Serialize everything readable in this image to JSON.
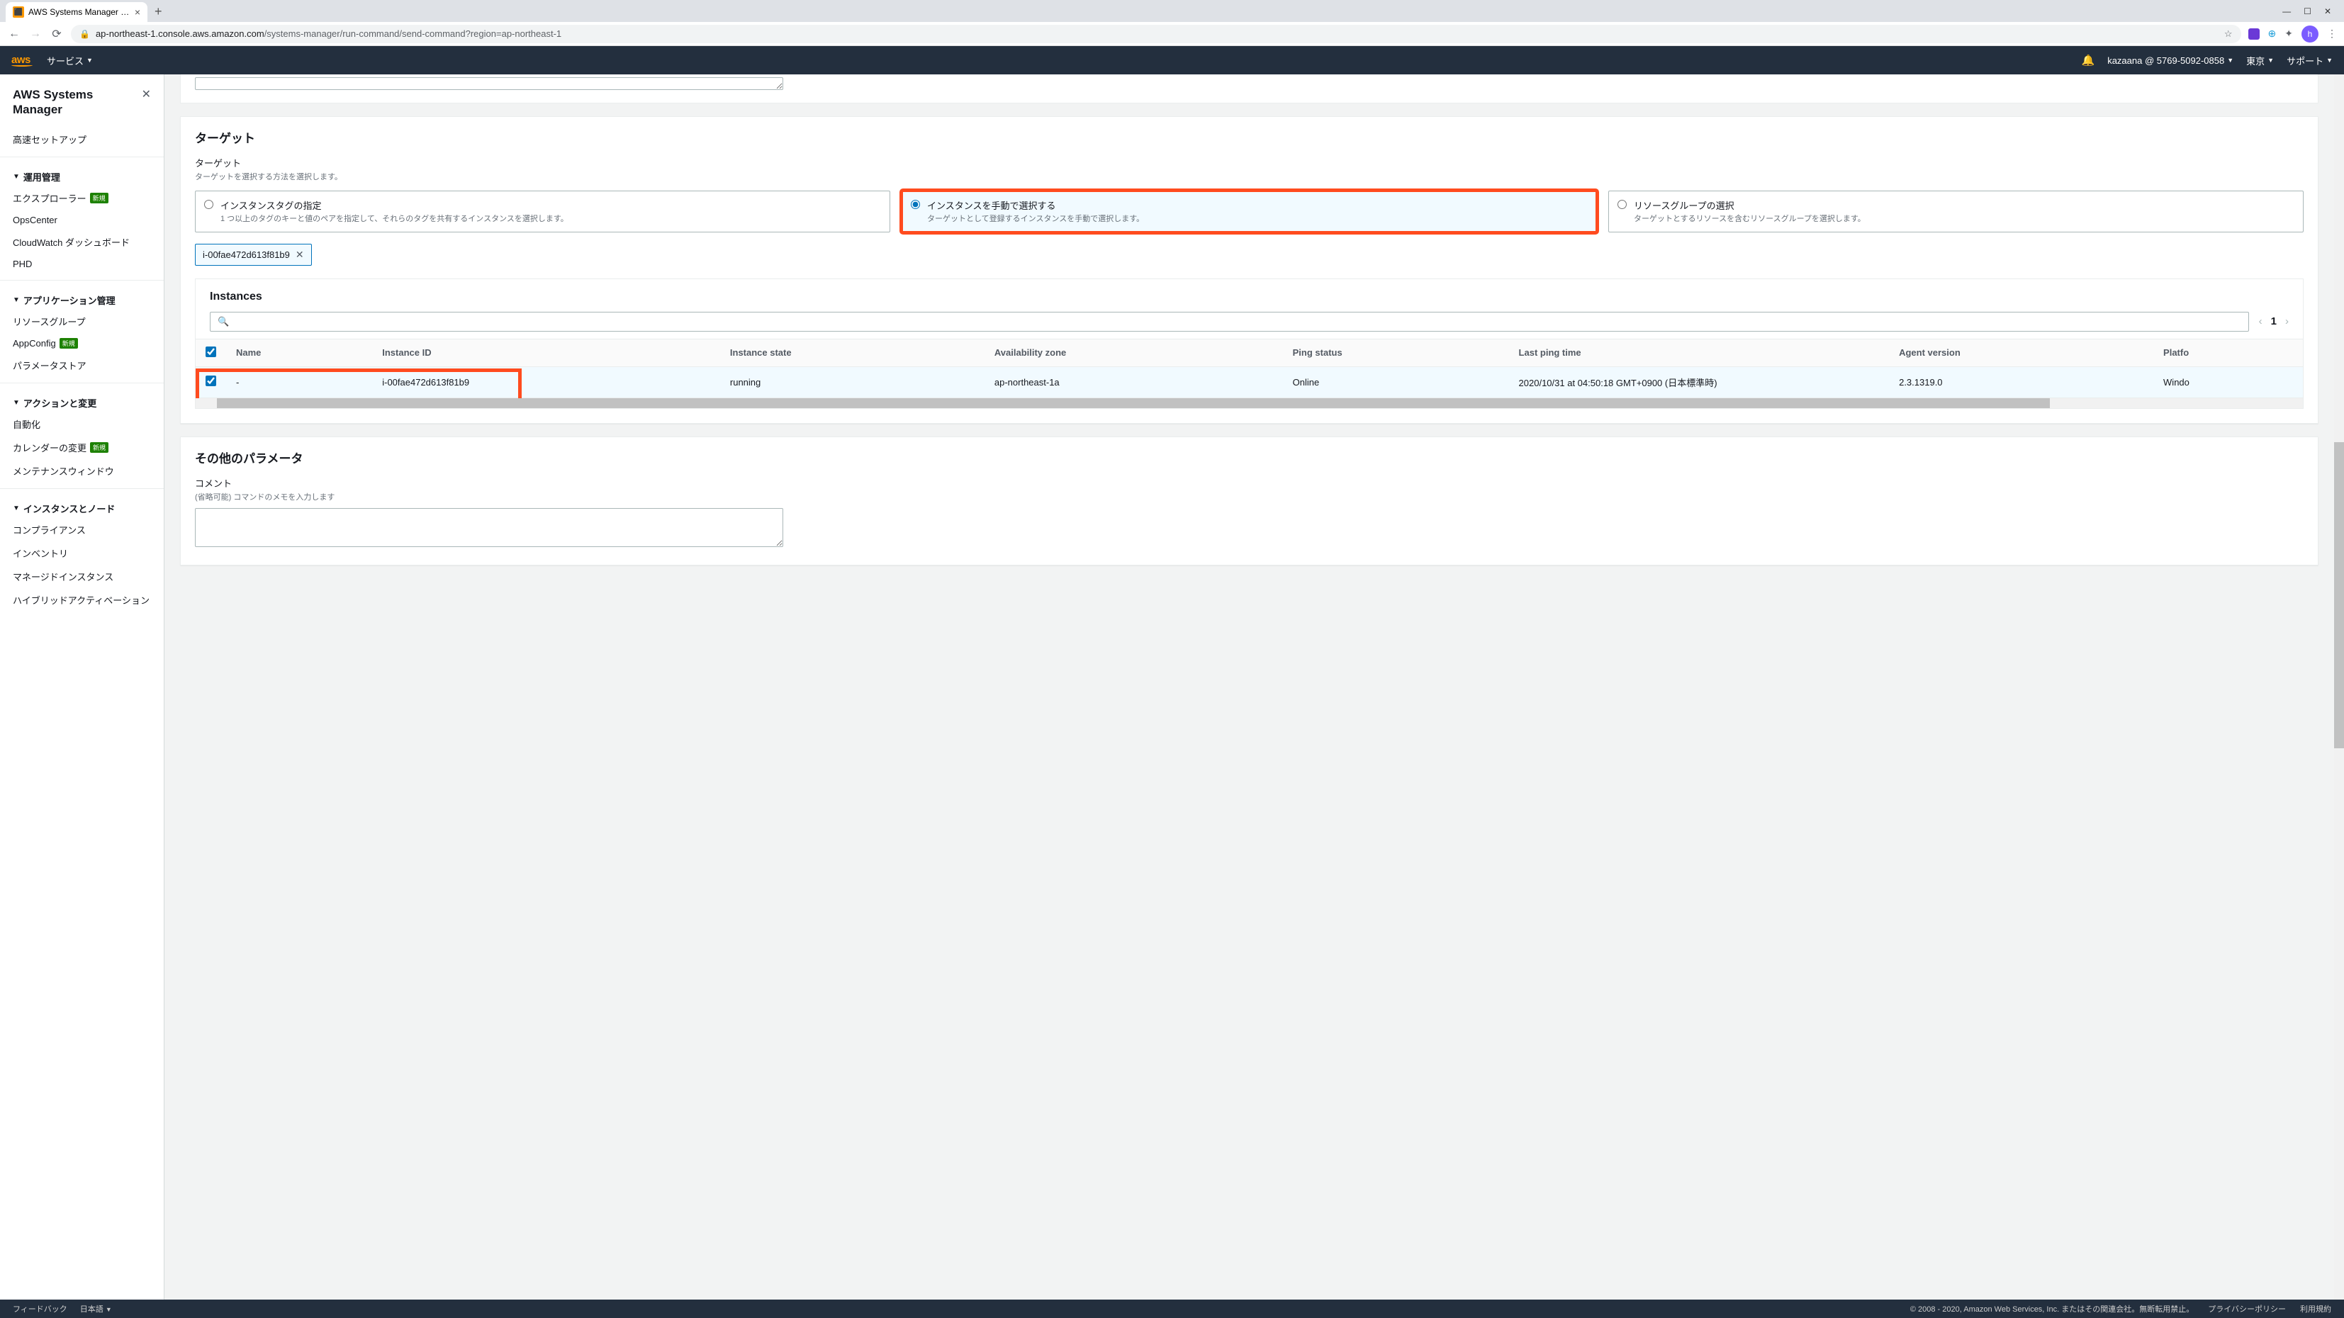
{
  "browser": {
    "tab_title": "AWS Systems Manager - Run Co",
    "url_host": "ap-northeast-1.console.aws.amazon.com",
    "url_path": "/systems-manager/run-command/send-command?region=ap-northeast-1",
    "avatar_letter": "h"
  },
  "aws_header": {
    "logo": "aws",
    "services": "サービス",
    "account": "kazaana @ 5769-5092-0858",
    "region": "東京",
    "support": "サポート"
  },
  "sidebar": {
    "title": "AWS Systems Manager",
    "quick_setup": "高速セットアップ",
    "sections": {
      "ops": {
        "label": "運用管理",
        "items": [
          "エクスプローラー",
          "OpsCenter",
          "CloudWatch ダッシュボード",
          "PHD"
        ],
        "new_badges": [
          0
        ]
      },
      "app": {
        "label": "アプリケーション管理",
        "items": [
          "リソースグループ",
          "AppConfig",
          "パラメータストア"
        ],
        "new_badges": [
          1
        ]
      },
      "actions": {
        "label": "アクションと変更",
        "items": [
          "自動化",
          "カレンダーの変更",
          "メンテナンスウィンドウ"
        ],
        "new_badges": [
          1
        ]
      },
      "instances": {
        "label": "インスタンスとノード",
        "items": [
          "コンプライアンス",
          "インベントリ",
          "マネージドインスタンス",
          "ハイブリッドアクティベーション"
        ],
        "new_badges": []
      }
    },
    "badge_text": "新規"
  },
  "targets_panel": {
    "title": "ターゲット",
    "field_label": "ターゲット",
    "field_help": "ターゲットを選択する方法を選択します。",
    "options": [
      {
        "title": "インスタンスタグの指定",
        "desc": "1 つ以上のタグのキーと値のペアを指定して、それらのタグを共有するインスタンスを選択します。"
      },
      {
        "title": "インスタンスを手動で選択する",
        "desc": "ターゲットとして登録するインスタンスを手動で選択します。"
      },
      {
        "title": "リソースグループの選択",
        "desc": "ターゲットとするリソースを含むリソースグループを選択します。"
      }
    ],
    "selected_instance_tag": "i-00fae472d613f81b9"
  },
  "instances_panel": {
    "title": "Instances",
    "page": "1",
    "columns": [
      "Name",
      "Instance ID",
      "Instance state",
      "Availability zone",
      "Ping status",
      "Last ping time",
      "Agent version",
      "Platfo"
    ],
    "row": {
      "name": "-",
      "instance_id": "i-00fae472d613f81b9",
      "state": "running",
      "az": "ap-northeast-1a",
      "ping": "Online",
      "last_ping": "2020/10/31 at 04:50:18 GMT+0900 (日本標準時)",
      "agent": "2.3.1319.0",
      "platform": "Windo"
    }
  },
  "other_params": {
    "title": "その他のパラメータ",
    "comment_label": "コメント",
    "comment_help": "(省略可能) コマンドのメモを入力します"
  },
  "footer": {
    "feedback": "フィードバック",
    "language": "日本語",
    "copyright": "© 2008 - 2020, Amazon Web Services, Inc. またはその関連会社。無断転用禁止。",
    "privacy": "プライバシーポリシー",
    "terms": "利用規約"
  }
}
